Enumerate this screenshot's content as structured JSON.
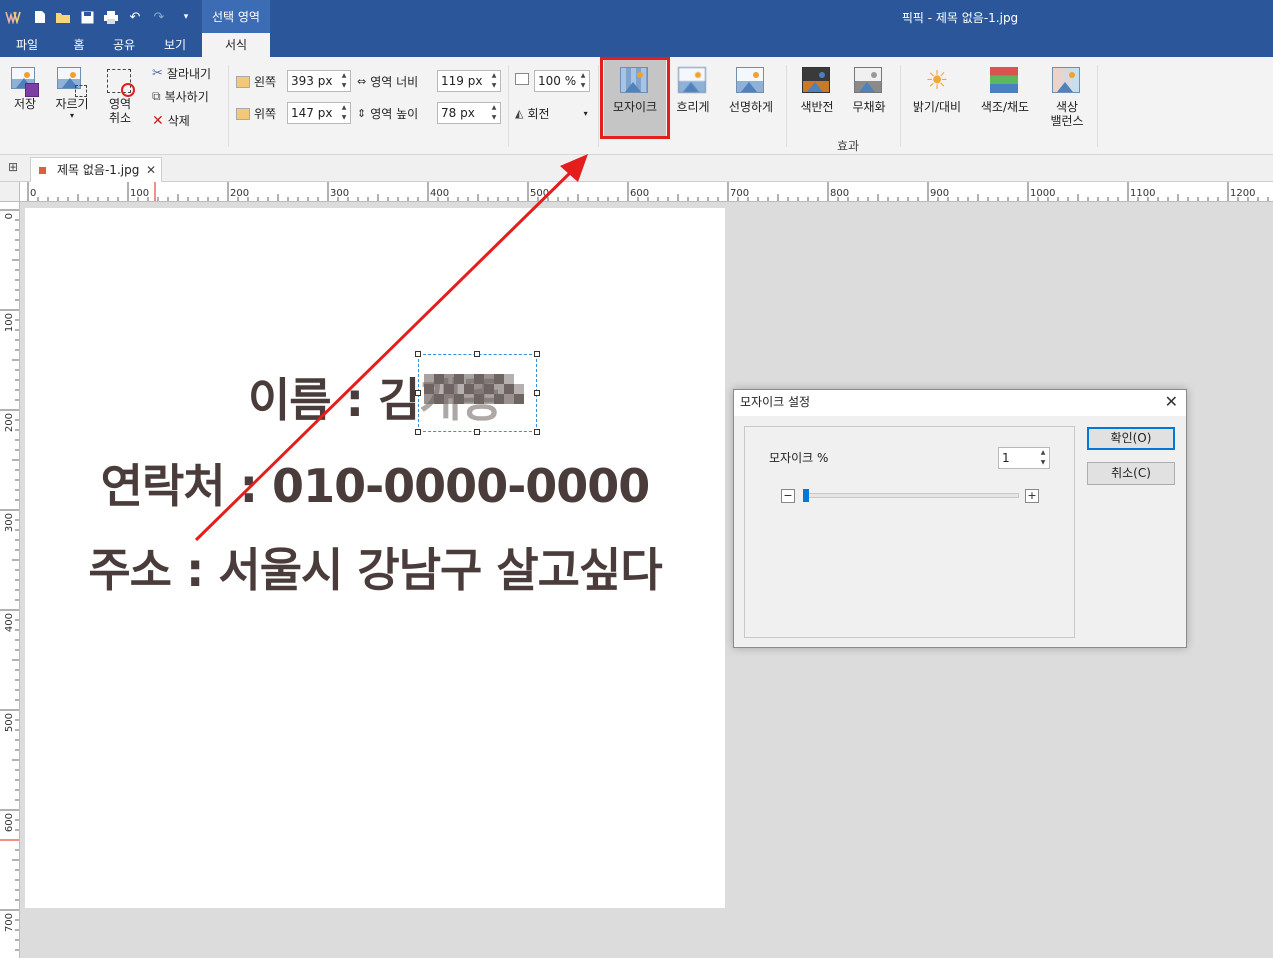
{
  "app": {
    "window_title": "픽픽 - 제목 없음-1.jpg",
    "context_tab": "선택 영역"
  },
  "menu_tabs": [
    "파일",
    "홈",
    "공유",
    "보기",
    "서식"
  ],
  "active_tab_index": 4,
  "ribbon": {
    "save": "저장",
    "crop": "자르기",
    "deselect_line1": "영역",
    "deselect_line2": "취소",
    "cut": "잘라내기",
    "copy": "복사하기",
    "delete": "삭제",
    "left_label": "왼쪽",
    "left_value": "393 px",
    "top_label": "위쪽",
    "top_value": "147 px",
    "width_label": "영역 너비",
    "width_value": "119 px",
    "height_label": "영역 높이",
    "height_value": "78 px",
    "zoom_value": "100 %",
    "rotate": "회전",
    "effects": {
      "mosaic": "모자이크",
      "blur": "흐리게",
      "sharpen": "선명하게",
      "invert": "색반전",
      "grayscale": "무채화",
      "brightness": "밝기/대비",
      "hue": "색조/채도",
      "balance_line1": "색상",
      "balance_line2": "밸런스"
    },
    "group_label": "효과"
  },
  "document_tab": "제목 없음-1.jpg",
  "ruler": {
    "h_labels": [
      "0",
      "100",
      "200",
      "300",
      "400",
      "500",
      "600",
      "700",
      "800",
      "900",
      "1000",
      "1100",
      "1200"
    ],
    "v_labels": [
      "0",
      "100",
      "200",
      "300",
      "400",
      "500",
      "600",
      "700"
    ]
  },
  "canvas_text": {
    "line1": "이름 : 김개똥",
    "line2": "연락처 : 010-0000-0000",
    "line3": "주소 : 서울시 강남구 살고싶다"
  },
  "dialog": {
    "title": "모자이크 설정",
    "label": "모자이크 %",
    "value": "1",
    "ok": "확인(O)",
    "cancel": "취소(C)"
  },
  "colors": {
    "titlebar": "#2b579a",
    "ribbon": "#f3f3f3",
    "highlight": "#e41d1d",
    "text": "#4a3c3a"
  }
}
